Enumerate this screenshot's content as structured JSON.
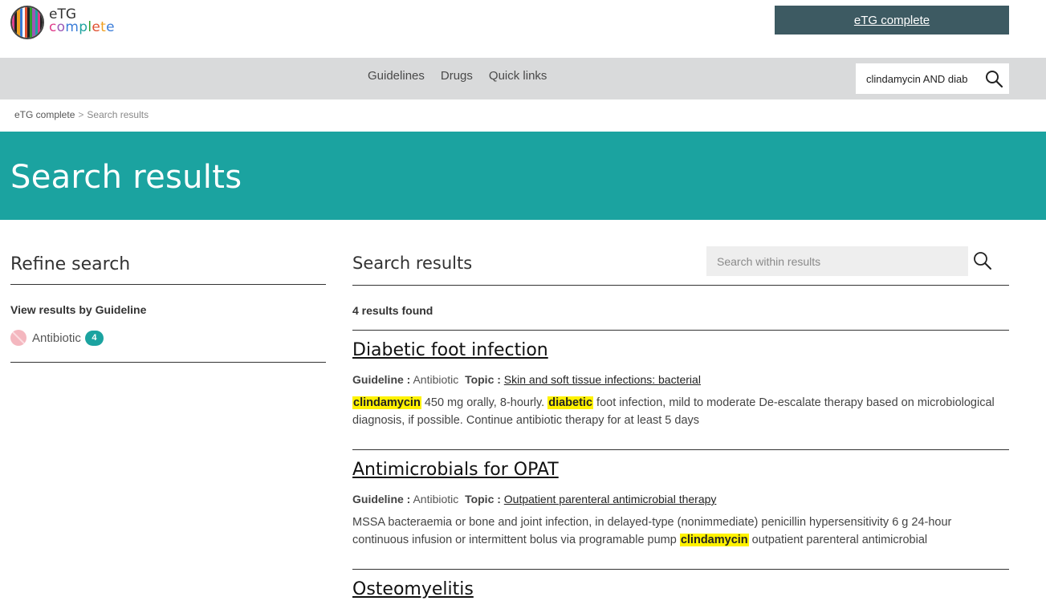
{
  "brand": {
    "line1": "eTG",
    "line2": "complete"
  },
  "header": {
    "product_button": "eTG complete"
  },
  "nav": {
    "links": [
      "Guidelines",
      "Drugs",
      "Quick links"
    ],
    "search_value": "clindamycin AND diab"
  },
  "breadcrumb": {
    "home": "eTG complete",
    "separator": ">",
    "current": "Search results"
  },
  "banner": {
    "title": "Search results"
  },
  "refine": {
    "title": "Refine search",
    "subtitle": "View results by Guideline",
    "facet": {
      "label": "Antibiotic",
      "count": "4"
    }
  },
  "results": {
    "title": "Search results",
    "within_placeholder": "Search within results",
    "found": "4 results found",
    "guideline_label": "Guideline :",
    "topic_label": "Topic :",
    "items": [
      {
        "title": "Diabetic foot infection",
        "guideline": "Antibiotic",
        "topic": "Skin and soft tissue infections: bacterial",
        "snippet": [
          {
            "t": "clindamycin",
            "hl": true
          },
          {
            "t": " 450 mg orally, 8-hourly. ",
            "hl": false
          },
          {
            "t": "diabetic",
            "hl": true
          },
          {
            "t": " foot infection, mild to moderate De-escalate therapy based on microbiological diagnosis, if possible. Continue antibiotic therapy for at least 5 days",
            "hl": false
          }
        ]
      },
      {
        "title": "Antimicrobials for OPAT",
        "guideline": "Antibiotic",
        "topic": "Outpatient parenteral antimicrobial therapy",
        "snippet": [
          {
            "t": "MSSA bacteraemia or bone and joint infection, in delayed-type (nonimmediate) penicillin hypersensitivity 6 g 24-hour continuous infusion or intermittent bolus via programable pump ",
            "hl": false
          },
          {
            "t": "clindamycin",
            "hl": true
          },
          {
            "t": " outpatient parenteral antimicrobial",
            "hl": false
          }
        ]
      },
      {
        "title": "Osteomyelitis"
      }
    ]
  },
  "colors": {
    "teal": "#1ba3a0",
    "dark_button": "#3d5a62",
    "nav_bg": "#d9dadb",
    "highlight": "#fff200"
  }
}
